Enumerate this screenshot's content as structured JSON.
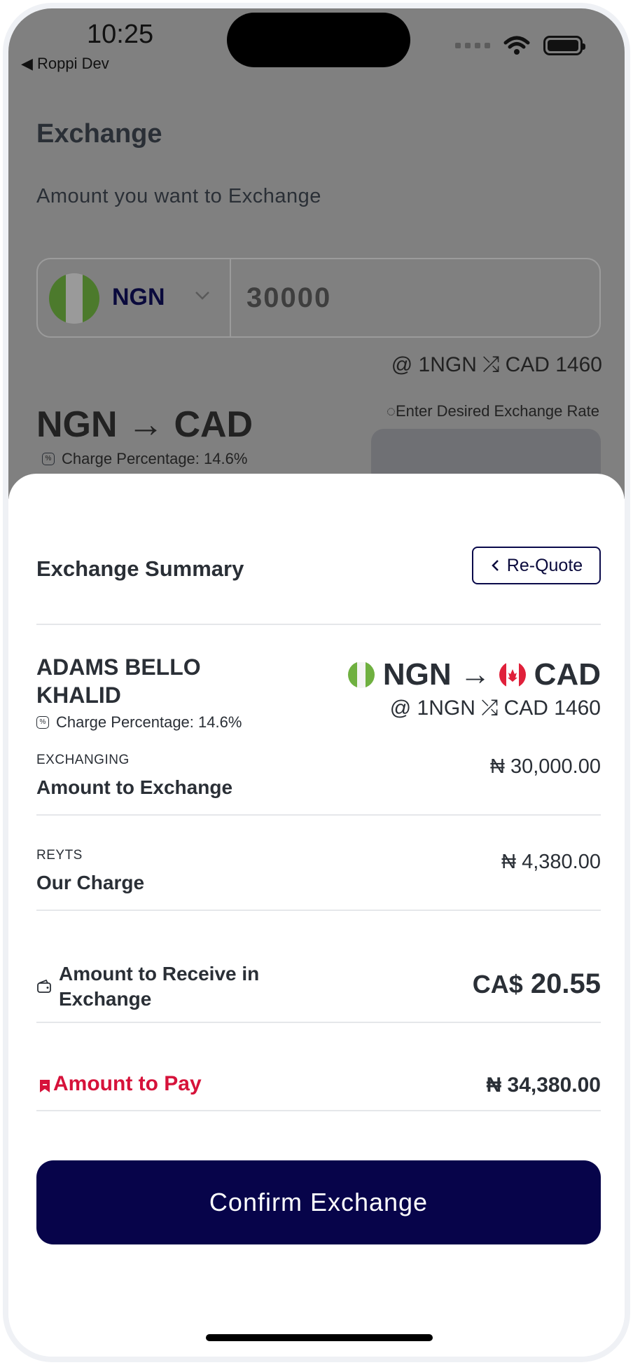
{
  "status_bar": {
    "time": "10:25",
    "back_label": "Roppi Dev"
  },
  "background_page": {
    "title": "Exchange",
    "subtitle": "Amount you want to Exchange",
    "currency_code": "NGN",
    "amount_value": "30000",
    "rate_text": "@ 1NGN ⤮ CAD 1460",
    "pair_text": "NGN → CAD",
    "charge_text": "Charge Percentage: 14.6%",
    "desired_rate_label": "Enter Desired Exchange Rate"
  },
  "sheet": {
    "title": "Exchange Summary",
    "requote_label": "Re-Quote",
    "customer_name": "ADAMS BELLO KHALID",
    "charge_text": "Charge Percentage: 14.6%",
    "from_currency": "NGN",
    "to_currency": "CAD",
    "arrow": "→",
    "rate_text": "@ 1NGN ⤮ CAD 1460",
    "rows": [
      {
        "small_label": "EXCHANGING",
        "label": "Amount to Exchange",
        "value": "₦ 30,000.00"
      },
      {
        "small_label": "REYTS",
        "label": "Our Charge",
        "value": "₦ 4,380.00"
      }
    ],
    "receive": {
      "label": "Amount to Receive in Exchange",
      "currency_prefix": "CA$",
      "value": "20.55"
    },
    "pay": {
      "label": "Amount to Pay",
      "value": "₦ 34,380.00"
    },
    "confirm_label": "Confirm Exchange"
  },
  "colors": {
    "brand_navy": "#07044a",
    "pay_red": "#d6123a",
    "text_dark": "#2a2f36",
    "nigeria_green": "#6fb040",
    "canada_red": "#e0203a"
  },
  "icons": [
    "wifi-icon",
    "battery-icon",
    "back-arrow-icon",
    "chevron-down-icon",
    "percent-badge-icon",
    "chevron-left-icon",
    "wallet-icon",
    "bookmark-icon",
    "nigeria-flag-icon",
    "canada-flag-icon",
    "shuffle-icon"
  ]
}
